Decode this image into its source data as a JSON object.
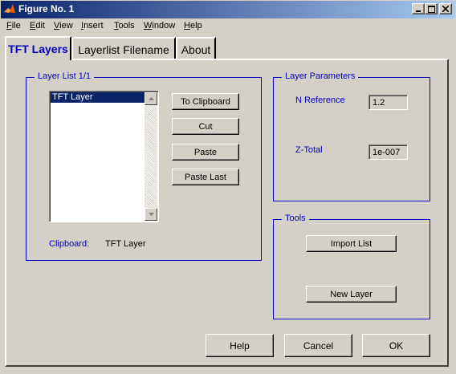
{
  "window": {
    "title": "Figure No. 1"
  },
  "menu": [
    {
      "label": "File",
      "u": "F",
      "rest": "ile"
    },
    {
      "label": "Edit",
      "u": "E",
      "rest": "dit"
    },
    {
      "label": "View",
      "u": "V",
      "rest": "iew"
    },
    {
      "label": "Insert",
      "u": "I",
      "rest": "nsert"
    },
    {
      "label": "Tools",
      "u": "T",
      "rest": "ools"
    },
    {
      "label": "Window",
      "u": "W",
      "rest": "indow"
    },
    {
      "label": "Help",
      "u": "H",
      "rest": "elp"
    }
  ],
  "tabs": [
    {
      "label": "TFT Layers",
      "active": true
    },
    {
      "label": "Layerlist Filename",
      "active": false
    },
    {
      "label": "About",
      "active": false
    }
  ],
  "layer_list": {
    "title": "Layer List 1/1",
    "items": [
      "TFT Layer"
    ],
    "selected_index": 0,
    "buttons": {
      "to_clipboard": "To Clipboard",
      "cut": "Cut",
      "paste": "Paste",
      "paste_last": "Paste Last"
    },
    "clipboard_label": "Clipboard:",
    "clipboard_value": "TFT Layer"
  },
  "layer_params": {
    "title": "Layer Parameters",
    "n_ref_label": "N Reference",
    "n_ref_value": "1.2",
    "z_total_label": "Z-Total",
    "z_total_value": "1e-007"
  },
  "tools": {
    "title": "Tools",
    "import_list": "Import List",
    "new_layer": "New Layer"
  },
  "footer": {
    "help": "Help",
    "cancel": "Cancel",
    "ok": "OK"
  },
  "colors": {
    "accent_blue": "#0000c0",
    "title_bar_start": "#0a246a",
    "title_bar_end": "#a6caf0",
    "face": "#d4d0c8",
    "selection": "#0a246a"
  }
}
